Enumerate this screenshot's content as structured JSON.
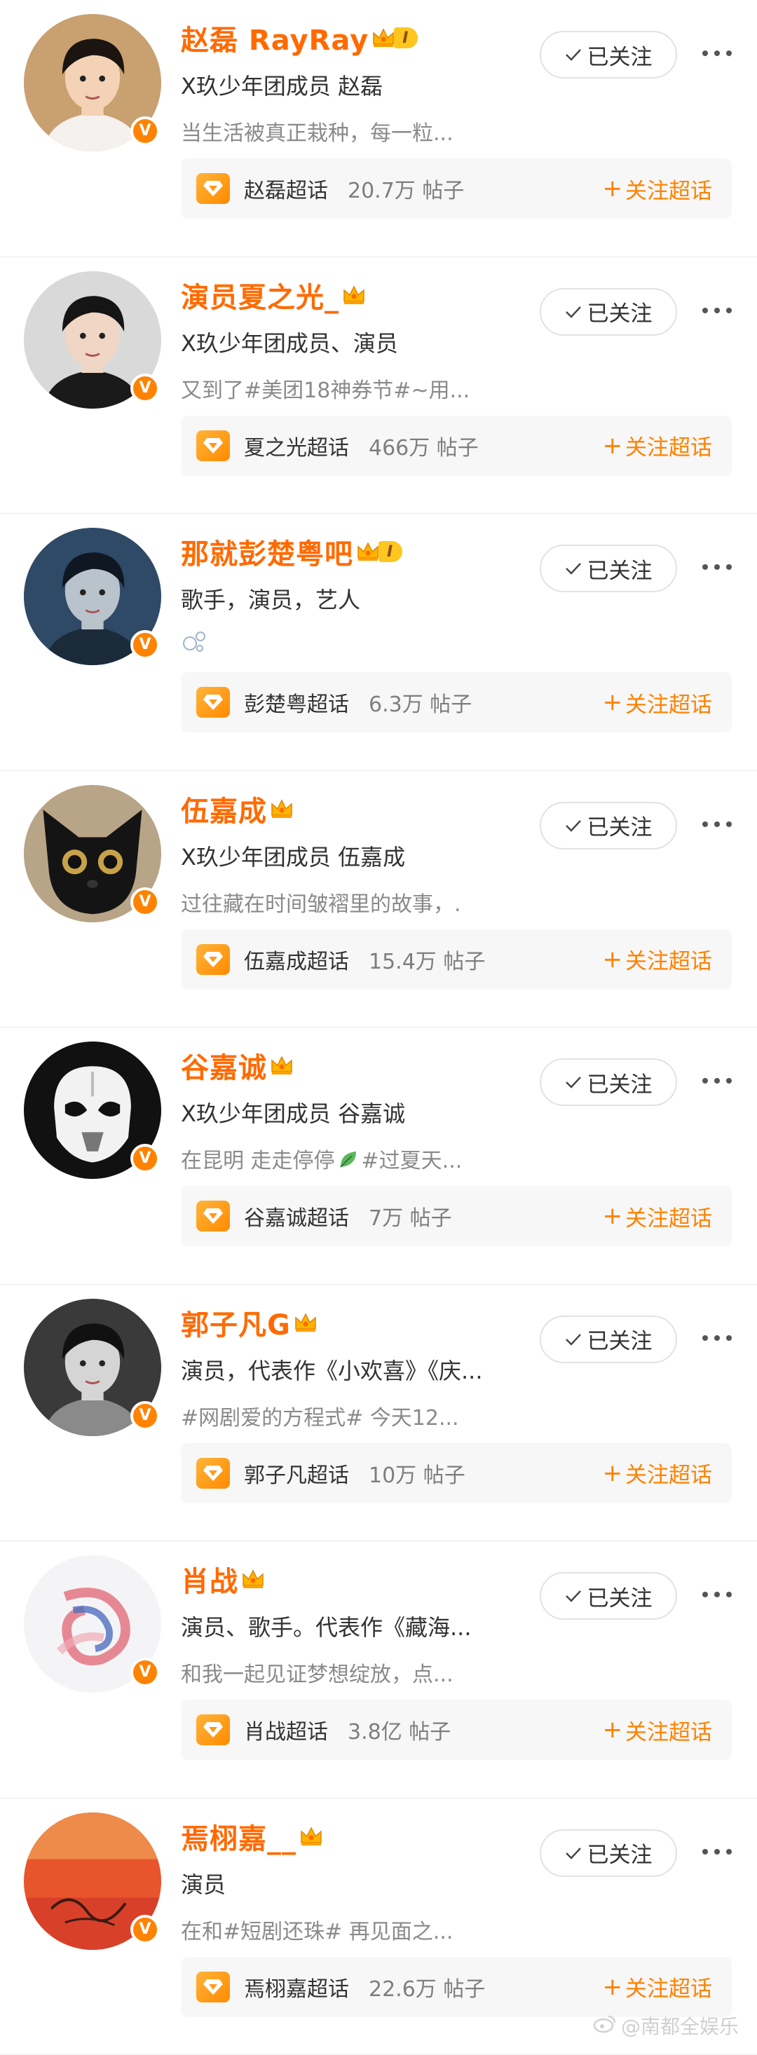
{
  "follow_label": "已关注",
  "topic_follow_label": "关注超话",
  "topic_follow_plus": "+",
  "level_badge": "I",
  "watermark": "@南都全娱乐",
  "colors": {
    "accent": "#ff8200",
    "name": "#ff6a00",
    "verified": "#ff8200"
  },
  "users": [
    {
      "name": "赵磊 RayRay",
      "line1": "X玖少年团成员 赵磊",
      "line2": "当生活被真正栽种，每一粒...",
      "topic": "赵磊超话",
      "count": "20.7万 帖子",
      "level_badge": true,
      "avatar": {
        "bg": "#c9a070",
        "skin": "#f3d2b5",
        "hair": "#1b1410",
        "shirt": "#f4f1ee"
      }
    },
    {
      "name": "演员夏之光_",
      "line1": "X玖少年团成员、演员",
      "line2": "又到了#美团18神券节#~用...",
      "topic": "夏之光超话",
      "count": "466万 帖子",
      "level_badge": false,
      "avatar": {
        "bg": "#d9d9d9",
        "skin": "#f0d6c4",
        "hair": "#151515",
        "shirt": "#1a1a1a"
      }
    },
    {
      "name": "那就彭楚粤吧",
      "line1": "歌手，演员，艺人",
      "line2": "",
      "line2_icon": "bubbles-icon",
      "topic": "彭楚粤超话",
      "count": "6.3万 帖子",
      "level_badge": true,
      "avatar": {
        "bg": "#2f4a66",
        "skin": "#b9c3cc",
        "hair": "#0f1720",
        "shirt": "#1c2b3a"
      }
    },
    {
      "name": "伍嘉成",
      "line1": "X玖少年团成员 伍嘉成",
      "line2": "过往藏在时间皱褶里的故事，.",
      "topic": "伍嘉成超话",
      "count": "15.4万 帖子",
      "level_badge": false,
      "avatar": {
        "bg": "#b8a486",
        "kind": "cat"
      }
    },
    {
      "name": "谷嘉诚",
      "line1": "X玖少年团成员 谷嘉诚",
      "line2": "在昆明 走走停停",
      "line2_suffix": "#过夏天...",
      "line2_icon": "leaf-icon",
      "topic": "谷嘉诚超话",
      "count": "7万 帖子",
      "level_badge": false,
      "avatar": {
        "bg": "#111111",
        "kind": "helmet"
      }
    },
    {
      "name": "郭子凡G",
      "line1": "演员，代表作《小欢喜》《庆...",
      "line2": "#网剧爱的方程式# 今天12...",
      "topic": "郭子凡超话",
      "count": "10万 帖子",
      "level_badge": false,
      "avatar": {
        "bg": "#3a3a3a",
        "skin": "#d5d5d5",
        "hair": "#111111",
        "shirt": "#8a8a8a"
      }
    },
    {
      "name": "肖战",
      "line1": "演员、歌手。代表作《藏海...",
      "line2": "和我一起见证梦想绽放，点...",
      "topic": "肖战超话",
      "count": "3.8亿 帖子",
      "level_badge": false,
      "avatar": {
        "bg": "#f4f4f6",
        "kind": "art"
      }
    },
    {
      "name": "焉栩嘉__",
      "line1": "演员",
      "line2": "在和#短剧还珠# 再见面之...",
      "topic": "焉栩嘉超话",
      "count": "22.6万 帖子",
      "level_badge": false,
      "avatar": {
        "bg": "#e8542c",
        "kind": "paint"
      }
    }
  ]
}
